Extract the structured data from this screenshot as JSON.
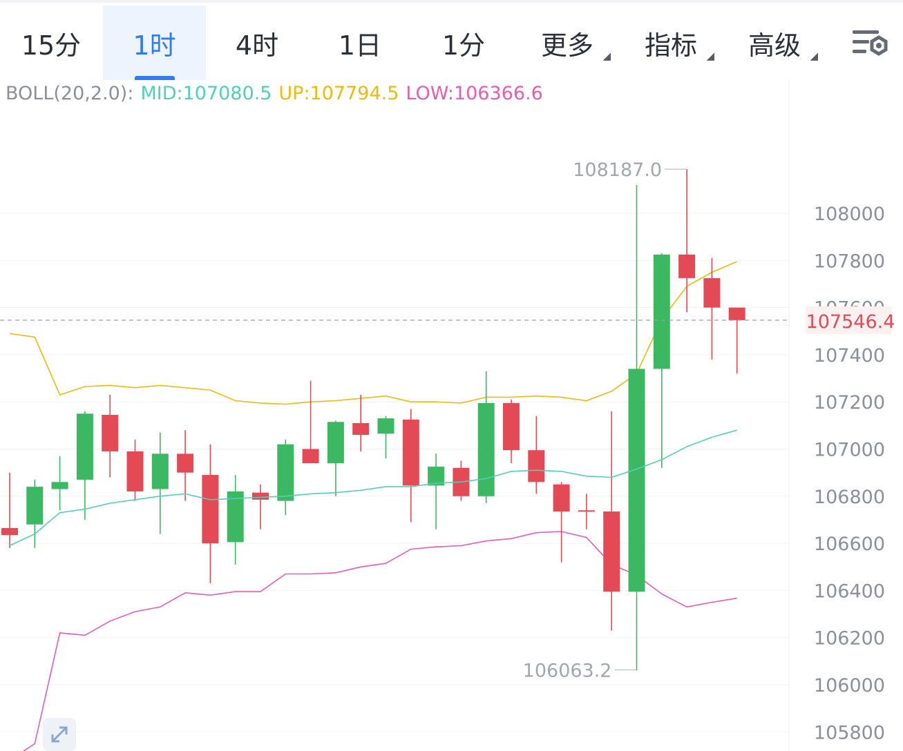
{
  "tabs": [
    {
      "label": "15分",
      "active": false,
      "dropdown": false
    },
    {
      "label": "1时",
      "active": true,
      "dropdown": false
    },
    {
      "label": "4时",
      "active": false,
      "dropdown": false
    },
    {
      "label": "1日",
      "active": false,
      "dropdown": false
    },
    {
      "label": "1分",
      "active": false,
      "dropdown": false
    },
    {
      "label": "更多",
      "active": false,
      "dropdown": true
    },
    {
      "label": "指标",
      "active": false,
      "dropdown": true
    },
    {
      "label": "高级",
      "active": false,
      "dropdown": true
    }
  ],
  "settings_icon": "chart-settings-icon",
  "expand_icon": "expand-icon",
  "indicator": {
    "name": "BOLL(20,2.0):",
    "mid": "MID:107080.5",
    "up": "UP:107794.5",
    "low": "LOW:106366.6"
  },
  "colors": {
    "up_candle": "#3cb862",
    "down_candle": "#e34a55",
    "mid_line": "#4fd1b5",
    "up_line": "#f0b90b",
    "low_line": "#e85ab4",
    "accent": "#2f7df0",
    "axis_text": "#8a8f99"
  },
  "chart_data": {
    "type": "candlestick",
    "ylim": [
      105700,
      108550
    ],
    "y_ticks": [
      "108000",
      "107800",
      "107600",
      "107400",
      "107200",
      "107000",
      "106800",
      "106600",
      "106400",
      "106200",
      "106000",
      "105800"
    ],
    "current_price": 107546.4,
    "current_price_label": "107546.4",
    "high_marker": {
      "value": 108187.0,
      "label": "108187.0"
    },
    "low_marker": {
      "value": 106063.2,
      "label": "106063.2"
    },
    "candles": [
      {
        "o": 106665,
        "h": 106900,
        "l": 106580,
        "c": 106635
      },
      {
        "o": 106680,
        "h": 106870,
        "l": 106580,
        "c": 106840
      },
      {
        "o": 106830,
        "h": 106970,
        "l": 106740,
        "c": 106860
      },
      {
        "o": 106870,
        "h": 107160,
        "l": 106700,
        "c": 107150
      },
      {
        "o": 107145,
        "h": 107230,
        "l": 106880,
        "c": 106990
      },
      {
        "o": 106990,
        "h": 107040,
        "l": 106780,
        "c": 106820
      },
      {
        "o": 106830,
        "h": 107070,
        "l": 106640,
        "c": 106980
      },
      {
        "o": 106980,
        "h": 107080,
        "l": 106780,
        "c": 106900
      },
      {
        "o": 106890,
        "h": 107020,
        "l": 106430,
        "c": 106600
      },
      {
        "o": 106605,
        "h": 106890,
        "l": 106510,
        "c": 106820
      },
      {
        "o": 106815,
        "h": 106850,
        "l": 106660,
        "c": 106785
      },
      {
        "o": 106780,
        "h": 107040,
        "l": 106720,
        "c": 107020
      },
      {
        "o": 107000,
        "h": 107290,
        "l": 106950,
        "c": 106940
      },
      {
        "o": 106940,
        "h": 107120,
        "l": 106800,
        "c": 107115
      },
      {
        "o": 107110,
        "h": 107230,
        "l": 106990,
        "c": 107060
      },
      {
        "o": 107065,
        "h": 107140,
        "l": 106960,
        "c": 107130
      },
      {
        "o": 107125,
        "h": 107170,
        "l": 106690,
        "c": 106845
      },
      {
        "o": 106845,
        "h": 106980,
        "l": 106660,
        "c": 106925
      },
      {
        "o": 106920,
        "h": 106950,
        "l": 106780,
        "c": 106800
      },
      {
        "o": 106800,
        "h": 107330,
        "l": 106770,
        "c": 107195
      },
      {
        "o": 107195,
        "h": 107210,
        "l": 106940,
        "c": 106995
      },
      {
        "o": 106995,
        "h": 107140,
        "l": 106810,
        "c": 106860
      },
      {
        "o": 106850,
        "h": 106860,
        "l": 106520,
        "c": 106735
      },
      {
        "o": 106740,
        "h": 106810,
        "l": 106660,
        "c": 106735
      },
      {
        "o": 106735,
        "h": 107160,
        "l": 106230,
        "c": 106395
      },
      {
        "o": 106395,
        "h": 108120,
        "l": 106060,
        "c": 107340
      },
      {
        "o": 107340,
        "h": 107830,
        "l": 106920,
        "c": 107825
      },
      {
        "o": 107825,
        "h": 108187,
        "l": 107580,
        "c": 107725
      },
      {
        "o": 107725,
        "h": 107810,
        "l": 107380,
        "c": 107600
      },
      {
        "o": 107600,
        "h": 107600,
        "l": 107320,
        "c": 107546.4
      }
    ],
    "boll_up": [
      107490,
      107475,
      107230,
      107265,
      107270,
      107260,
      107270,
      107260,
      107250,
      107205,
      107195,
      107190,
      107200,
      107205,
      107215,
      107225,
      107200,
      107200,
      107195,
      107220,
      107220,
      107225,
      107220,
      107205,
      107245,
      107320,
      107550,
      107690,
      107750,
      107795
    ],
    "boll_mid": [
      106590,
      106640,
      106730,
      106745,
      106770,
      106785,
      106800,
      106810,
      106785,
      106790,
      106795,
      106800,
      106810,
      106815,
      106825,
      106840,
      106840,
      106855,
      106860,
      106875,
      106905,
      106910,
      106905,
      106885,
      106880,
      106915,
      106955,
      107010,
      107050,
      107080
    ],
    "boll_low": [
      105680,
      105750,
      106220,
      106210,
      106270,
      106310,
      106330,
      106390,
      106380,
      106395,
      106395,
      106470,
      106470,
      106475,
      106500,
      106515,
      106575,
      106585,
      106590,
      106610,
      106620,
      106645,
      106650,
      106625,
      106510,
      106465,
      106385,
      106330,
      106350,
      106367
    ]
  }
}
